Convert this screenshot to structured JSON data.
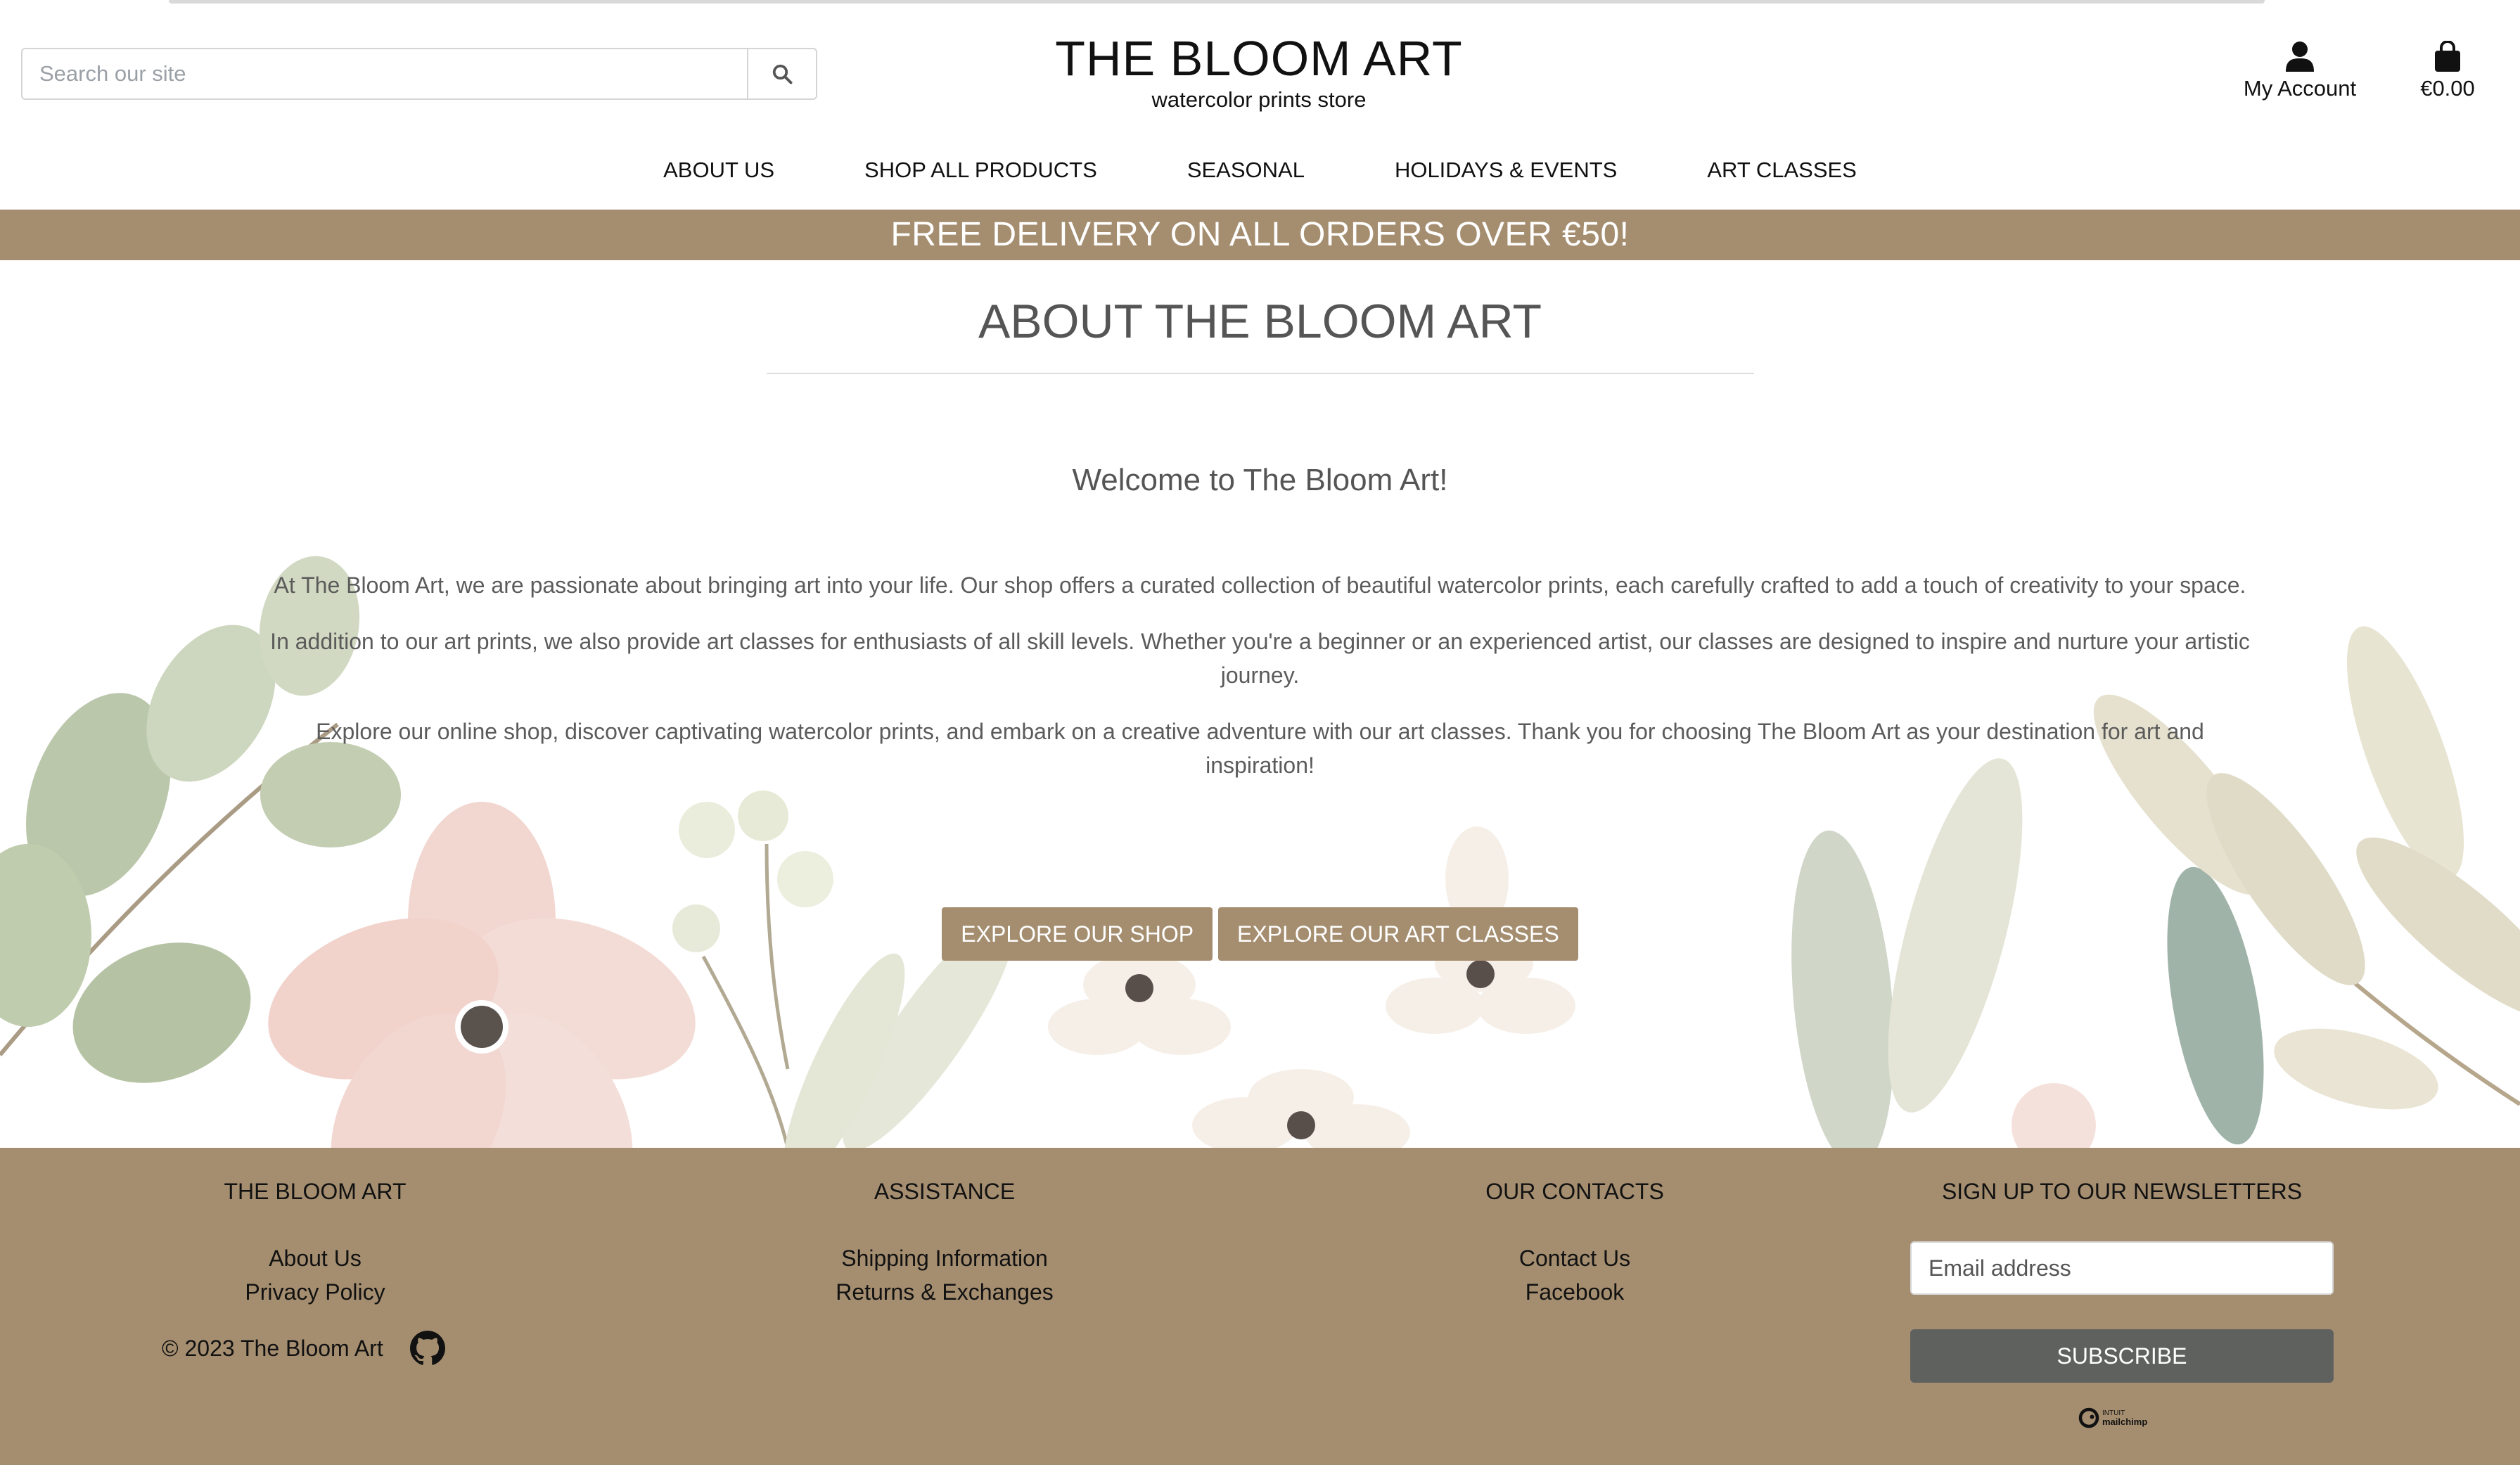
{
  "search": {
    "placeholder": "Search our site"
  },
  "brand": {
    "title": "THE BLOOM ART",
    "subtitle": "watercolor prints store"
  },
  "account": {
    "label": "My Account"
  },
  "cart": {
    "total": "€0.00"
  },
  "nav": [
    "ABOUT US",
    "SHOP ALL PRODUCTS",
    "SEASONAL",
    "HOLIDAYS & EVENTS",
    "ART CLASSES"
  ],
  "banner": "FREE DELIVERY ON ALL ORDERS OVER €50!",
  "main": {
    "title": "ABOUT THE BLOOM ART",
    "welcome": "Welcome to The Bloom Art!",
    "p1": "At The Bloom Art, we are passionate about bringing art into your life. Our shop offers a curated collection of beautiful watercolor prints, each carefully crafted to add a touch of creativity to your space.",
    "p2": "In addition to our art prints, we also provide art classes for enthusiasts of all skill levels. Whether you're a beginner or an experienced artist, our classes are designed to inspire and nurture your artistic journey.",
    "p3": "Explore our online shop, discover captivating watercolor prints, and embark on a creative adventure with our art classes. Thank you for choosing The Bloom Art as your destination for art and inspiration!",
    "btn_shop": "EXPLORE OUR SHOP",
    "btn_classes": "EXPLORE OUR ART CLASSES"
  },
  "footer": {
    "col1": {
      "title": "THE BLOOM ART",
      "links": [
        "About Us",
        "Privacy Policy"
      ],
      "copyright": "© 2023 The Bloom Art"
    },
    "col2": {
      "title": "ASSISTANCE",
      "links": [
        "Shipping Information",
        "Returns & Exchanges"
      ]
    },
    "col3": {
      "title": "OUR CONTACTS",
      "links": [
        "Contact Us",
        "Facebook"
      ]
    },
    "col4": {
      "title": "SIGN UP TO OUR NEWSLETTERS",
      "email_placeholder": "Email address",
      "subscribe": "SUBSCRIBE",
      "mailchimp_top": "INTUIT",
      "mailchimp_bottom": "mailchimp"
    }
  },
  "colors": {
    "accent": "#a58e70",
    "subscribe": "#5f615f"
  },
  "icons": [
    "search-icon",
    "user-icon",
    "shopping-bag-icon",
    "github-icon",
    "mailchimp-logo"
  ]
}
